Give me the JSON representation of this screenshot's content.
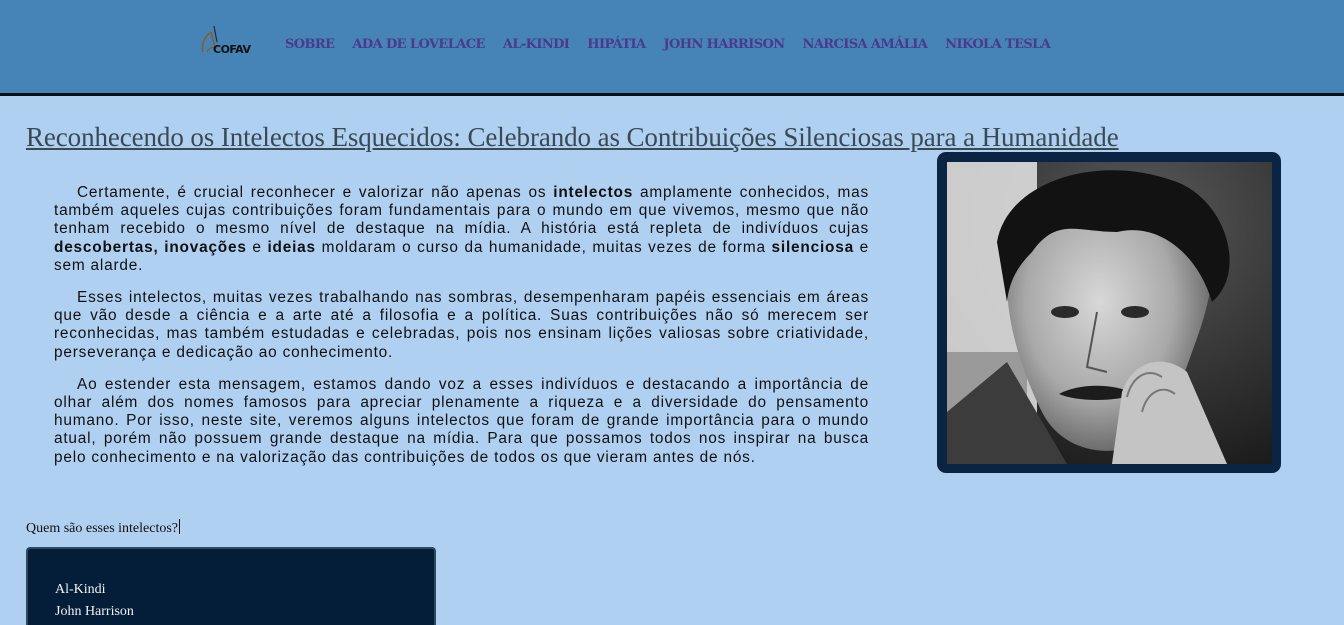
{
  "header": {
    "logo_text": "COFAV",
    "nav": [
      "SOBRE",
      "ADA DE LOVELACE",
      "AL-KINDI",
      "HIPÁTIA",
      "JOHN HARRISON",
      "NARCISA AMÁLIA",
      "NIKOLA TESLA"
    ]
  },
  "main": {
    "title": "Reconhecendo os Intelectos Esquecidos: Celebrando as Contribuições Silenciosas para a Humanidade",
    "p1": [
      "Certamente, é crucial reconhecer e valorizar não apenas os ",
      "intelectos",
      " amplamente conhecidos, mas também aqueles cujas contribuições foram fundamentais para o mundo em que vivemos, mesmo que não tenham recebido o mesmo nível de destaque na mídia. A história está repleta de indivíduos cujas ",
      "descobertas, inovações",
      " e ",
      "ideias",
      " moldaram o curso da humanidade, muitas vezes de forma ",
      "silenciosa",
      " e sem alarde."
    ],
    "p2": "Esses intelectos, muitas vezes trabalhando nas sombras, desempenharam papéis essenciais em áreas que vão desde a ciência e a arte até a filosofia e a política. Suas contribuições não só merecem ser reconhecidas, mas também estudadas e celebradas, pois nos ensinam lições valiosas sobre criatividade, perseverança e dedicação ao conhecimento.",
    "p3": "Ao estender esta mensagem, estamos dando voz a esses indivíduos e destacando a importância de olhar além dos nomes famosos para apreciar plenamente a riqueza e a diversidade do pensamento humano. Por isso, neste site, veremos alguns intelectos que foram de grande importância para o mundo atual, porém não possuem grande destaque na mídia. Para que possamos todos nos inspirar na busca pelo conhecimento e na valorização das contribuições de todos os que vieram antes de nós.",
    "question": "Quem são esses intelectos?",
    "list": [
      "Al-Kindi",
      "John Harrison"
    ]
  }
}
